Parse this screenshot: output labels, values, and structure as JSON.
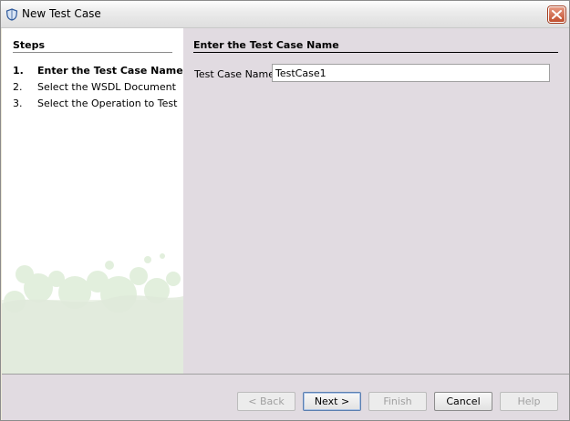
{
  "window": {
    "title": "New Test Case"
  },
  "steps": {
    "heading": "Steps",
    "items": [
      {
        "num": "1.",
        "label": "Enter the Test Case Name",
        "active": true
      },
      {
        "num": "2.",
        "label": "Select the WSDL Document",
        "active": false
      },
      {
        "num": "3.",
        "label": "Select the Operation to Test",
        "active": false
      }
    ]
  },
  "content": {
    "heading": "Enter the Test Case Name",
    "field_label": "Test Case Name:",
    "field_value": "TestCase1"
  },
  "buttons": {
    "back": "< Back",
    "next": "Next >",
    "finish": "Finish",
    "cancel": "Cancel",
    "help": "Help"
  },
  "icons": {
    "app": "shield-app-icon",
    "close": "close-icon"
  },
  "colors": {
    "content_bg": "#e1dbe1",
    "close_red": "#c1502f"
  }
}
